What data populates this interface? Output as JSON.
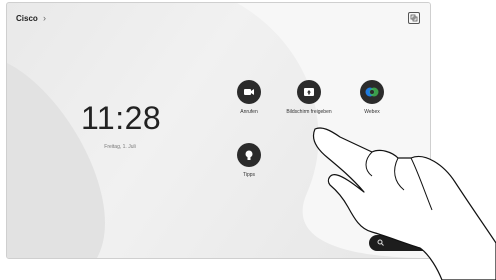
{
  "header": {
    "brand": "Cisco",
    "chevron": "›"
  },
  "clock": {
    "time": "11:28",
    "date": "Freitag, 1. Juli"
  },
  "apps": [
    {
      "label": "Anrufen",
      "icon": "video-camera-icon"
    },
    {
      "label": "Bildschirm freigeben",
      "icon": "share-screen-icon"
    },
    {
      "label": "Webex",
      "icon": "webex-logo-icon"
    },
    {
      "label": "Tipps",
      "icon": "lightbulb-icon"
    }
  ],
  "colors": {
    "button": "#2b2b2b",
    "background": "#ececec",
    "webex_blue": "#1f7ae0",
    "webex_green": "#3fb34f"
  }
}
